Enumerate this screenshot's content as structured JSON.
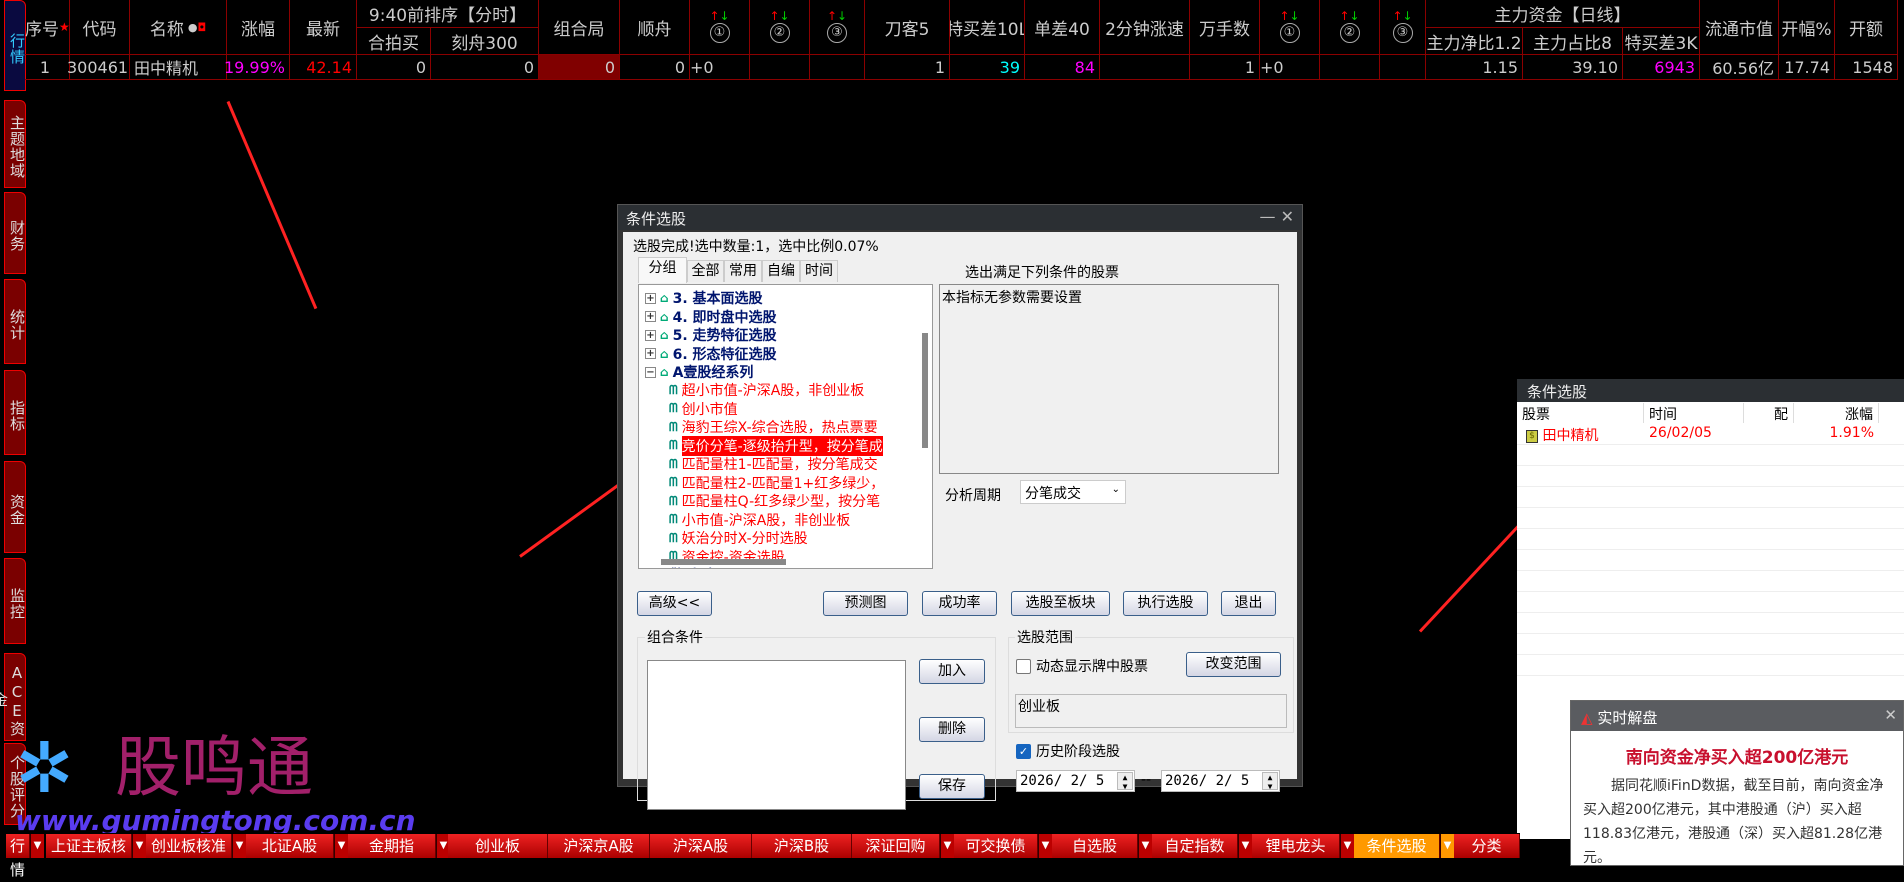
{
  "sidebar": {
    "tabs": [
      "行情",
      "主题地域",
      "财务",
      "统计",
      "指标",
      "资金",
      "监控",
      "ACE资金",
      "个股评分"
    ]
  },
  "grid": {
    "headers": {
      "seq": "序号",
      "code": "代码",
      "name": "名称",
      "chg": "涨幅",
      "last": "最新",
      "grp1": "9:40前排序【分时】",
      "hepaimai": "合拍买",
      "kezhou": "刻舟300",
      "zuheju": "组合局",
      "shunzhou": "顺舟",
      "c1": "①",
      "c2": "②",
      "c3": "③",
      "daoke": "刀客5",
      "temaicha": "特买差10L",
      "dancha": "单差40",
      "zhangsu": "2分钟涨速",
      "wanshou": "万手数",
      "d1": "①",
      "d2": "②",
      "d3": "③",
      "grp2": "主力资金【日线】",
      "jingbi": "主力净比1.2",
      "zhanbi": "主力占比8",
      "temaicha3k": "特买差3K",
      "liutong": "流通市值",
      "kaifu": "开幅%",
      "kaie": "开额"
    },
    "row": {
      "seq": "1",
      "code": "300461",
      "name": "田中精机",
      "chg": "19.99%",
      "last": "42.14",
      "hepaimai": "0",
      "kezhou": "0",
      "zuheju": "0",
      "shunzhou": "0",
      "c": "+0",
      "daoke": "1",
      "temaicha": "39",
      "dancha": "84",
      "wanshou": "1",
      "d": "+0",
      "jingbi": "1.15",
      "zhanbi": "39.10",
      "temaicha3k": "6943",
      "liutong": "60.56亿",
      "kaifu": "17.74",
      "kaie": "1548"
    }
  },
  "dialog": {
    "title": "条件选股",
    "status": "选股完成!选中数量:1，选中比例0.07%",
    "tabs": [
      "分组",
      "全部",
      "常用",
      "自编",
      "时间"
    ],
    "right_heading": "选出满足下列条件的股票",
    "param_text": "本指标无参数需要设置",
    "period_label": "分析周期",
    "period_value": "分笔成交",
    "tree": {
      "groups": [
        "3. 基本面选股",
        "4. 即时盘中选股",
        "5. 走势特征选股",
        "6. 形态特征选股",
        "A壹股经系列"
      ],
      "leaves": [
        "超小市值-沪深A股，非创业板",
        "创小市值",
        "海豹王综X-综合选股，热点票要",
        "竞价分笔-逐级抬升型，按分笔成",
        "匹配量柱1-匹配量，按分笔成交",
        "匹配量柱2-匹配量1+红多绿少，",
        "匹配量柱Q-红多绿少型，按分笔",
        "小市值-沪深A股，非创业板",
        "妖治分时X-分时选股",
        "资金控-资金选股"
      ],
      "selected": "竞价分笔-逐级抬升型，按分笔成",
      "partial": "A预警系列"
    },
    "buttons": {
      "advanced": "高级<<",
      "forecast": "预测图",
      "success": "成功率",
      "to_block": "选股至板块",
      "execute": "执行选股",
      "exit": "退出",
      "add": "加入",
      "delete": "删除",
      "save": "保存",
      "change_range": "改变范围"
    },
    "combo_label": "组合条件",
    "range_label": "选股范围",
    "dynamic_label": "动态显示牌中股票",
    "dynamic_checked": false,
    "range_value": "创业板",
    "history_label": "历史阶段选股",
    "history_checked": true,
    "date_from": "2026/ 2/ 5",
    "date_sep": "--",
    "date_to": "2026/ 2/ 5"
  },
  "result_panel": {
    "title": "条件选股",
    "headers": [
      "股票",
      "时间",
      "配",
      "涨幅"
    ],
    "rows": [
      {
        "stock": "田中精机",
        "time": "26/02/05",
        "pei": "",
        "chg": "1.91%"
      }
    ]
  },
  "popup": {
    "title": "实时解盘",
    "headline": "南向资金净买入超200亿港元",
    "body": "据同花顺iFinD数据，截至目前，南向资金净买入超200亿港元，其中港股通（沪）买入超118.83亿港元，港股通（深）买入超81.28亿港元。"
  },
  "watermark": {
    "logo_text": "股鸣通",
    "url": "www.gumingtong.com.cn"
  },
  "bottom_tabs": [
    "行情",
    "上证主板核",
    "创业板核准",
    "北证A股",
    "金期指",
    "创业板",
    "沪深京A股",
    "沪深A股",
    "沪深B股",
    "深证回购",
    "可交换债",
    "自选股",
    "自定指数",
    "锂电龙头",
    "条件选股",
    "分类"
  ],
  "colors": {
    "up": "#ff0000",
    "magenta": "#ff00ff",
    "cyan": "#00ffff",
    "grid_line": "#8b0000",
    "tab_red": "#cc1111",
    "tab_selected": "#ff9900"
  }
}
